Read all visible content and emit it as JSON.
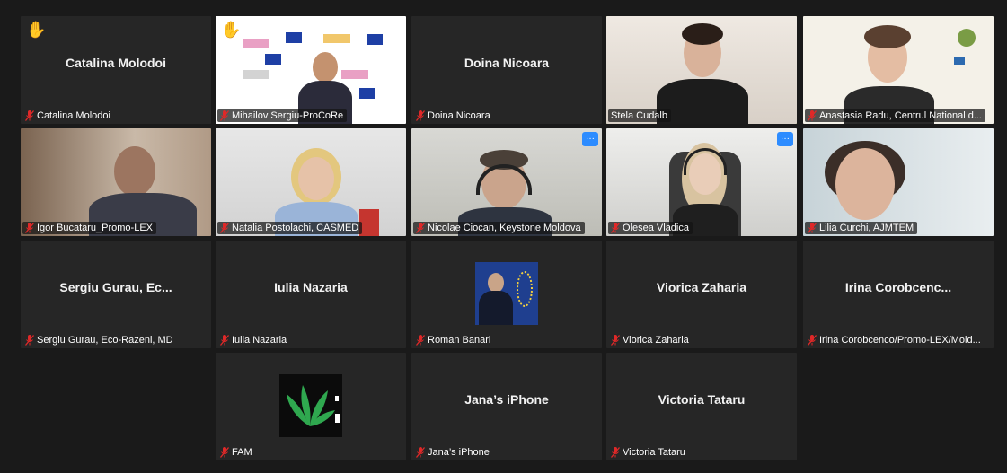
{
  "participants": [
    {
      "display": "Catalina Molodoi",
      "label": "Catalina Molodoi",
      "hand": true
    },
    {
      "display": "",
      "label": "Mihailov Sergiu-ProCoRe",
      "hand": true
    },
    {
      "display": "Doina Nicoara",
      "label": "Doina Nicoara"
    },
    {
      "display": "",
      "label": "Stela Cudalb",
      "speaking": true
    },
    {
      "display": "",
      "label": "Anastasia Radu, Centrul National d..."
    },
    {
      "display": "",
      "label": "Igor Bucataru_Promo-LEX"
    },
    {
      "display": "",
      "label": "Natalia Postolachi, CASMED"
    },
    {
      "display": "",
      "label": "Nicolae Ciocan, Keystone Moldova"
    },
    {
      "display": "",
      "label": "Olesea Vladica"
    },
    {
      "display": "",
      "label": "Lilia Curchi, AJMTEM"
    },
    {
      "display": "Sergiu Gurau, Ec...",
      "label": "Sergiu Gurau, Eco-Razeni, MD"
    },
    {
      "display": "Iulia Nazaria",
      "label": "Iulia Nazaria"
    },
    {
      "display": "",
      "label": "Roman Banari"
    },
    {
      "display": "Viorica Zaharia",
      "label": "Viorica Zaharia"
    },
    {
      "display": "Irina  Corobcenc...",
      "label": "Irina Corobcenco/Promo-LEX/Mold..."
    },
    {
      "display": "",
      "label": "FAM"
    },
    {
      "display": "Jana’s iPhone",
      "label": "Jana’s iPhone"
    },
    {
      "display": "Victoria Tataru",
      "label": "Victoria Tataru"
    }
  ],
  "icons": {
    "hand": "✋",
    "more": "···",
    "muted_mic": "muted-mic-icon"
  },
  "colors": {
    "speaking_border": "#a6d83c",
    "muted_mic": "#e02828",
    "more_button": "#2d8cff"
  }
}
